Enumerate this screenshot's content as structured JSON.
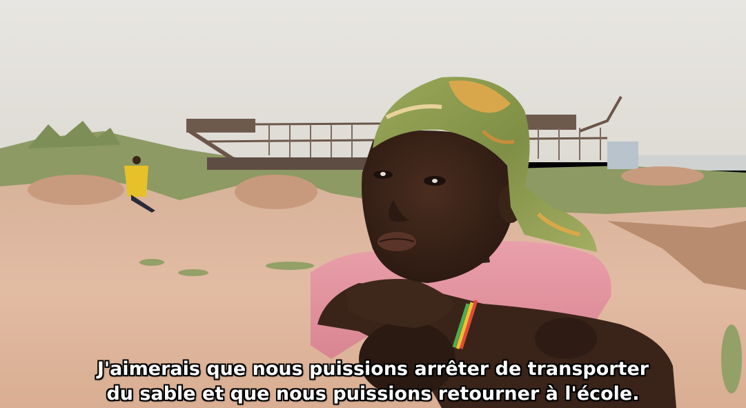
{
  "video_frame": {
    "subtitle_lines": [
      "J'aimerais que nous puissions arrêter de transporter",
      "du sable et que nous puissions retourner à l'école."
    ]
  },
  "colors": {
    "sky": "#e4e1dc",
    "sand": "#e0b69a",
    "grass": "#8a9a5c",
    "shirt": "#e48f9b",
    "headscarf": "#8c9a4e",
    "skin": "#3b2418",
    "boat": "#6c5a4e",
    "worker_shirt": "#e7c12a"
  }
}
